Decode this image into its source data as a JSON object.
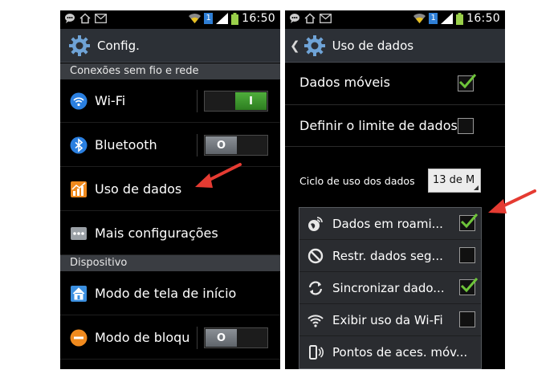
{
  "status_bar": {
    "time": "16:50",
    "sim_badge": "1"
  },
  "left_screen": {
    "title": "Config.",
    "section_connections": "Conexões sem fio e rede",
    "items": [
      {
        "label": "Wi-Fi",
        "icon": "wifi-icon",
        "toggle": "on",
        "toggle_text": "I"
      },
      {
        "label": "Bluetooth",
        "icon": "bluetooth-icon",
        "toggle": "off",
        "toggle_text": "O"
      },
      {
        "label": "Uso de dados",
        "icon": "data-usage-icon"
      },
      {
        "label": "Mais configurações",
        "icon": "more-icon"
      }
    ],
    "section_device": "Dispositivo",
    "device_items": [
      {
        "label": "Modo de tela de início",
        "icon": "home-icon"
      },
      {
        "label": "Modo de bloqu",
        "icon": "block-icon",
        "toggle": "off",
        "toggle_text": "O"
      }
    ]
  },
  "right_screen": {
    "title": "Uso de dados",
    "mobile_data": {
      "label": "Dados móveis",
      "checked": true
    },
    "limit": {
      "label": "Definir o limite de dados",
      "checked": false
    },
    "cycle": {
      "label": "Ciclo de uso dos dados",
      "value": "13 de M"
    },
    "menu": [
      {
        "label": "Dados em roami...",
        "icon": "roaming-icon",
        "checked": true
      },
      {
        "label": "Restr. dados seg...",
        "icon": "restrict-icon",
        "checked": false
      },
      {
        "label": "Sincronizar dado...",
        "icon": "sync-icon",
        "checked": true
      },
      {
        "label": "Exibir uso da Wi-Fi",
        "icon": "wifi-icon",
        "checked": false
      },
      {
        "label": "Pontos de aces. móv...",
        "icon": "hotspot-icon"
      }
    ]
  },
  "colors": {
    "accent_green": "#6ec43a",
    "arrow_red": "#e53b32",
    "toggle_green": "#3f9a2e"
  }
}
